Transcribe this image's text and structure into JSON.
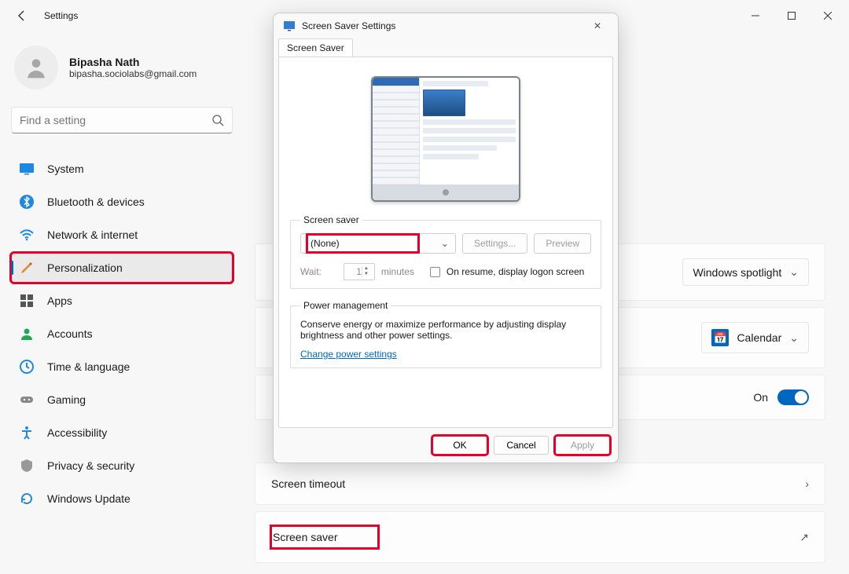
{
  "window": {
    "title": "Settings"
  },
  "user": {
    "name": "Bipasha Nath",
    "email": "bipasha.sociolabs@gmail.com"
  },
  "search": {
    "placeholder": "Find a setting"
  },
  "nav": [
    {
      "id": "system",
      "label": "System"
    },
    {
      "id": "bluetooth",
      "label": "Bluetooth & devices"
    },
    {
      "id": "network",
      "label": "Network & internet"
    },
    {
      "id": "personalization",
      "label": "Personalization",
      "selected": true
    },
    {
      "id": "apps",
      "label": "Apps"
    },
    {
      "id": "accounts",
      "label": "Accounts"
    },
    {
      "id": "time",
      "label": "Time & language"
    },
    {
      "id": "gaming",
      "label": "Gaming"
    },
    {
      "id": "accessibility",
      "label": "Accessibility"
    },
    {
      "id": "privacy",
      "label": "Privacy & security"
    },
    {
      "id": "update",
      "label": "Windows Update"
    }
  ],
  "main": {
    "spotlight_value": "Windows spotlight",
    "calendar_label": "Calendar",
    "lockstatus_state": "On",
    "timeout_label": "Screen timeout",
    "saver_label": "Screen saver"
  },
  "dialog": {
    "title": "Screen Saver Settings",
    "tab": "Screen Saver",
    "ss_group": "Screen saver",
    "ss_value": "(None)",
    "settings_btn": "Settings...",
    "preview_btn": "Preview",
    "wait_label": "Wait:",
    "wait_value": "1",
    "wait_unit": "minutes",
    "resume_label": "On resume, display logon screen",
    "pm_group": "Power management",
    "pm_text": "Conserve energy or maximize performance by adjusting display brightness and other power settings.",
    "pm_link": "Change power settings",
    "ok": "OK",
    "cancel": "Cancel",
    "apply": "Apply"
  }
}
